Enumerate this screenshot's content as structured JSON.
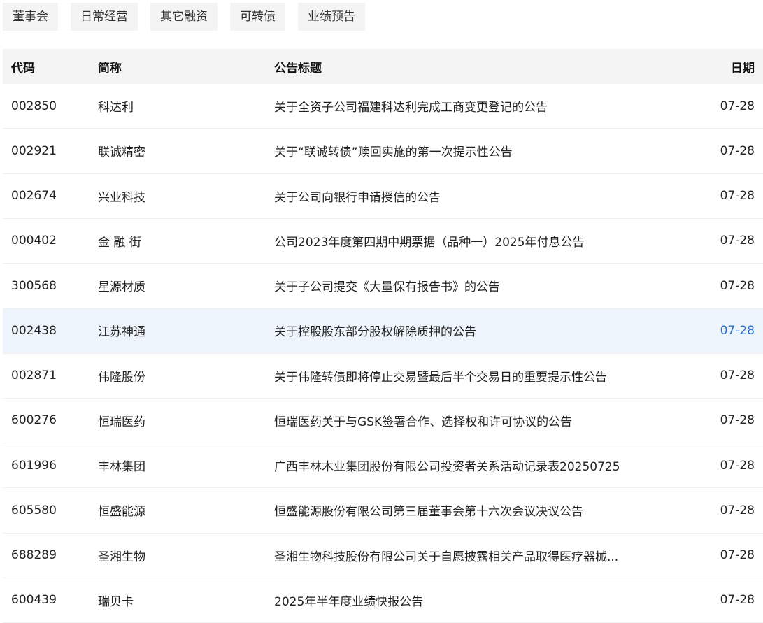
{
  "tabs": [
    "董事会",
    "日常经营",
    "其它融资",
    "可转债",
    "业绩预告"
  ],
  "table": {
    "headers": {
      "code": "代码",
      "name": "简称",
      "title": "公告标题",
      "date": "日期"
    },
    "rows": [
      {
        "code": "002850",
        "name": "科达利",
        "title": "关于全资子公司福建科达利完成工商变更登记的公告",
        "date": "07-28"
      },
      {
        "code": "002921",
        "name": "联诚精密",
        "title": "关于“联诚转债”赎回实施的第一次提示性公告",
        "date": "07-28"
      },
      {
        "code": "002674",
        "name": "兴业科技",
        "title": "关于公司向银行申请授信的公告",
        "date": "07-28"
      },
      {
        "code": "000402",
        "name": "金 融 街",
        "title": "公司2023年度第四期中期票据（品种一）2025年付息公告",
        "date": "07-28"
      },
      {
        "code": "300568",
        "name": "星源材质",
        "title": "关于子公司提交《大量保有报告书》的公告",
        "date": "07-28"
      },
      {
        "code": "002438",
        "name": "江苏神通",
        "title": "关于控股股东部分股权解除质押的公告",
        "date": "07-28"
      },
      {
        "code": "002871",
        "name": "伟隆股份",
        "title": "关于伟隆转债即将停止交易暨最后半个交易日的重要提示性公告",
        "date": "07-28"
      },
      {
        "code": "600276",
        "name": "恒瑞医药",
        "title": "恒瑞医药关于与GSK签署合作、选择权和许可协议的公告",
        "date": "07-28"
      },
      {
        "code": "601996",
        "name": "丰林集团",
        "title": "广西丰林木业集团股份有限公司投资者关系活动记录表20250725",
        "date": "07-28"
      },
      {
        "code": "605580",
        "name": "恒盛能源",
        "title": "恒盛能源股份有限公司第三届董事会第十六次会议决议公告",
        "date": "07-28"
      },
      {
        "code": "688289",
        "name": "圣湘生物",
        "title": "圣湘生物科技股份有限公司关于自愿披露相关产品取得医疗器械...",
        "date": "07-28"
      },
      {
        "code": "600439",
        "name": "瑞贝卡",
        "title": "2025年半年度业绩快报公告",
        "date": "07-28"
      }
    ]
  },
  "colors": {
    "highlight_row_bg": "#eef4fb",
    "highlight_date": "#2a6fc9",
    "header_bg": "#f4f4f4"
  }
}
